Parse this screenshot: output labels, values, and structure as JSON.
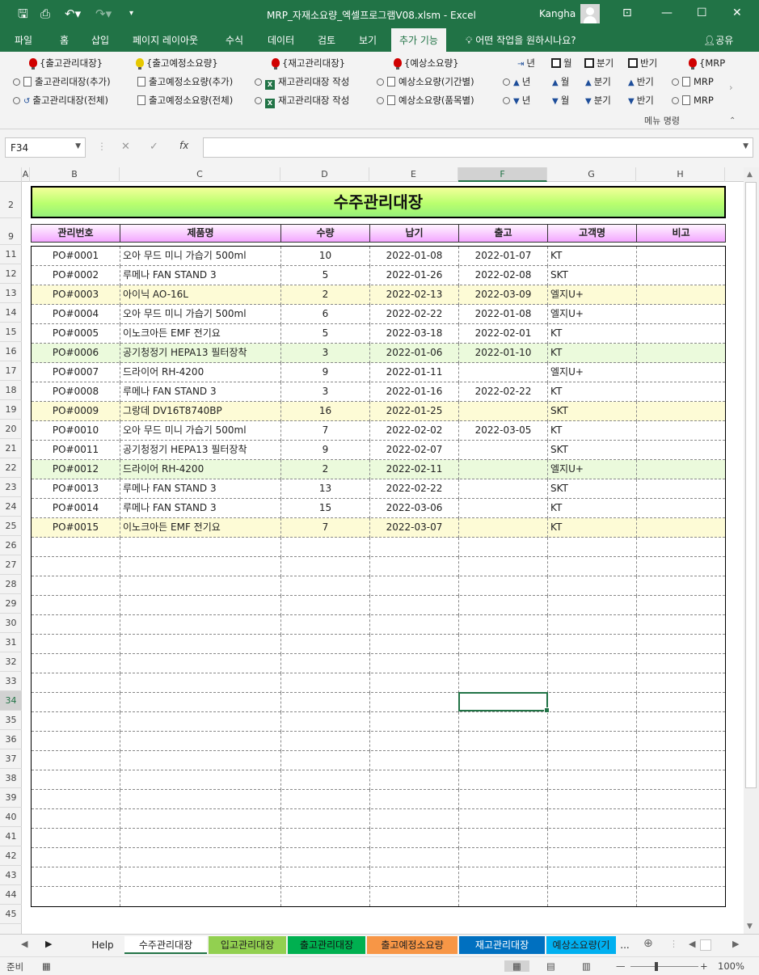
{
  "window": {
    "title": "MRP_자재소요량_엑셀프로그램V08.xlsm  -  Excel",
    "user": "Kangha"
  },
  "tabs": [
    {
      "label": "파일"
    },
    {
      "label": "홈"
    },
    {
      "label": "삽입"
    },
    {
      "label": "페이지 레이아웃"
    },
    {
      "label": "수식"
    },
    {
      "label": "데이터"
    },
    {
      "label": "검토"
    },
    {
      "label": "보기"
    },
    {
      "label": "추가 기능"
    }
  ],
  "tellme": "어떤 작업을 원하시나요?",
  "share": "공유",
  "ribbon": {
    "row1": [
      "{출고관리대장}",
      "{출고예정소요량}",
      "{재고관리대장}",
      "{예상소요량}",
      "년",
      "월",
      "분기",
      "반기",
      "{MRP"
    ],
    "row2": [
      "출고관리대장(추가)",
      "출고예정소요량(추가)",
      "재고관리대장 작성",
      "예상소요량(기간별)",
      "년",
      "월",
      "분기",
      "반기",
      "MRP"
    ],
    "row3": [
      "출고관리대장(전체)",
      "출고예정소요량(전체)",
      "재고관리대장 작성",
      "예상소요량(품목별)",
      "년",
      "월",
      "분기",
      "반기",
      "MRP"
    ],
    "group_label": "메뉴 명령"
  },
  "formula_bar": {
    "name_box": "F34",
    "fx": "fx",
    "content": ""
  },
  "columns": [
    "A",
    "B",
    "C",
    "D",
    "E",
    "F",
    "G",
    "H"
  ],
  "rows": [
    "2",
    "9",
    "11",
    "12",
    "13",
    "14",
    "15",
    "16",
    "17",
    "18",
    "19",
    "20",
    "21",
    "22",
    "23",
    "24",
    "25",
    "26",
    "27",
    "28",
    "29",
    "30",
    "31",
    "32",
    "33",
    "34",
    "35",
    "36",
    "37",
    "38",
    "39",
    "40",
    "41",
    "42",
    "43",
    "44",
    "45"
  ],
  "sheet": {
    "title": "수주관리대장",
    "headers": [
      "관리번호",
      "제품명",
      "수량",
      "납기",
      "출고",
      "고객명",
      "비고"
    ],
    "data": [
      {
        "no": "PO#0001",
        "product": "오아 무드 미니 가습기 500ml",
        "qty": "10",
        "due": "2022-01-08",
        "ship": "2022-01-07",
        "customer": "KT",
        "note": "",
        "band": "none"
      },
      {
        "no": "PO#0002",
        "product": "루메나 FAN STAND 3",
        "qty": "5",
        "due": "2022-01-26",
        "ship": "2022-02-08",
        "customer": "SKT",
        "note": "",
        "band": "none"
      },
      {
        "no": "PO#0003",
        "product": "아이닉 AO-16L",
        "qty": "2",
        "due": "2022-02-13",
        "ship": "2022-03-09",
        "customer": "엘지U+",
        "note": "",
        "band": "yellow"
      },
      {
        "no": "PO#0004",
        "product": "오아 무드 미니 가습기 500ml",
        "qty": "6",
        "due": "2022-02-22",
        "ship": "2022-01-08",
        "customer": "엘지U+",
        "note": "",
        "band": "none"
      },
      {
        "no": "PO#0005",
        "product": "이노크아든 EMF 전기요",
        "qty": "5",
        "due": "2022-03-18",
        "ship": "2022-02-01",
        "customer": "KT",
        "note": "",
        "band": "none"
      },
      {
        "no": "PO#0006",
        "product": "공기청정기 HEPA13 필터장착",
        "qty": "3",
        "due": "2022-01-06",
        "ship": "2022-01-10",
        "customer": "KT",
        "note": "",
        "band": "green"
      },
      {
        "no": "PO#0007",
        "product": "드라이어 RH-4200",
        "qty": "9",
        "due": "2022-01-11",
        "ship": "",
        "customer": "엘지U+",
        "note": "",
        "band": "none"
      },
      {
        "no": "PO#0008",
        "product": "루메나 FAN STAND 3",
        "qty": "3",
        "due": "2022-01-16",
        "ship": "2022-02-22",
        "customer": "KT",
        "note": "",
        "band": "none"
      },
      {
        "no": "PO#0009",
        "product": "그랑데 DV16T8740BP",
        "qty": "16",
        "due": "2022-01-25",
        "ship": "",
        "customer": "SKT",
        "note": "",
        "band": "yellow"
      },
      {
        "no": "PO#0010",
        "product": "오아 무드 미니 가습기 500ml",
        "qty": "7",
        "due": "2022-02-02",
        "ship": "2022-03-05",
        "customer": "KT",
        "note": "",
        "band": "none"
      },
      {
        "no": "PO#0011",
        "product": "공기청정기 HEPA13 필터장착",
        "qty": "9",
        "due": "2022-02-07",
        "ship": "",
        "customer": "SKT",
        "note": "",
        "band": "none"
      },
      {
        "no": "PO#0012",
        "product": "드라이어 RH-4200",
        "qty": "2",
        "due": "2022-02-11",
        "ship": "",
        "customer": "엘지U+",
        "note": "",
        "band": "green"
      },
      {
        "no": "PO#0013",
        "product": "루메나 FAN STAND 3",
        "qty": "13",
        "due": "2022-02-22",
        "ship": "",
        "customer": "SKT",
        "note": "",
        "band": "none"
      },
      {
        "no": "PO#0014",
        "product": "루메나 FAN STAND 3",
        "qty": "15",
        "due": "2022-03-06",
        "ship": "",
        "customer": "KT",
        "note": "",
        "band": "none"
      },
      {
        "no": "PO#0015",
        "product": "이노크아든 EMF 전기요",
        "qty": "7",
        "due": "2022-03-07",
        "ship": "",
        "customer": "KT",
        "note": "",
        "band": "yellow"
      }
    ],
    "empty_rows": 19
  },
  "sheet_tabs": [
    {
      "label": "Help",
      "color": "#f3f3f3"
    },
    {
      "label": "수주관리대장",
      "color": "#ffffff",
      "active": true
    },
    {
      "label": "입고관리대장",
      "color": "#92d050"
    },
    {
      "label": "출고관리대장",
      "color": "#00b050"
    },
    {
      "label": "출고예정소요량",
      "color": "#f79646"
    },
    {
      "label": "재고관리대장",
      "color": "#0070c0"
    },
    {
      "label": "예상소요량(기",
      "color": "#00b0f0"
    },
    {
      "label": "...",
      "color": "#f3f3f3"
    }
  ],
  "status": {
    "ready": "준비",
    "zoom": "100%"
  },
  "colors": {
    "excel_green": "#217346",
    "banner_fill": "#b9ff6e",
    "header_fill": "#f3a7ff",
    "band_green": "#ebfadc",
    "band_yellow": "#fdfbd6"
  }
}
